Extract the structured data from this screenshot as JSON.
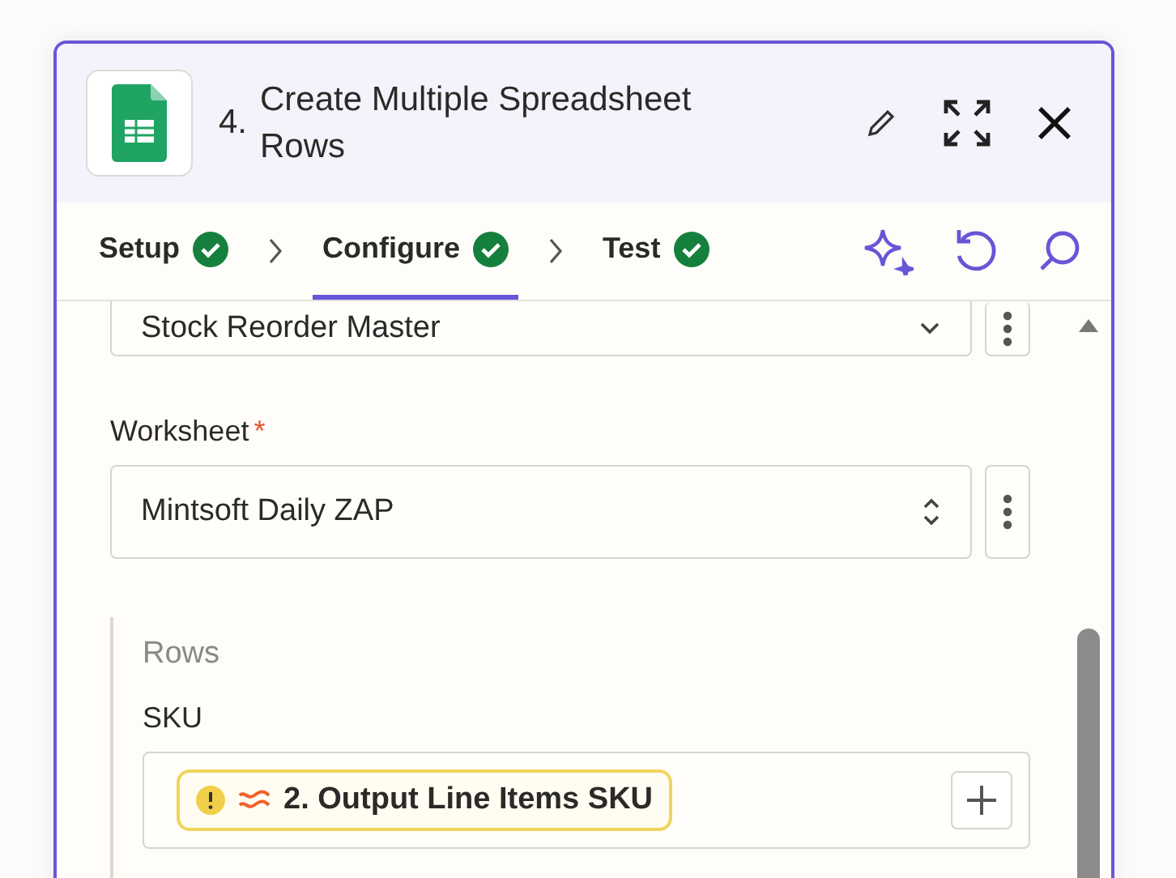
{
  "header": {
    "step": "4.",
    "title": "Create Multiple Spreadsheet Rows"
  },
  "steps": [
    {
      "label": "Setup",
      "selected": false,
      "complete": true
    },
    {
      "label": "Configure",
      "selected": true,
      "complete": true
    },
    {
      "label": "Test",
      "selected": false,
      "complete": true
    }
  ],
  "fields": [
    {
      "kind": "dropdown",
      "value": "Stock Reorder Master"
    },
    {
      "kind": "select",
      "label": "Worksheet",
      "required_mark": "*",
      "value": "Mintsoft Daily ZAP"
    }
  ],
  "rows_section": {
    "title": "Rows",
    "fields": [
      {
        "label": "SKU",
        "token": {
          "text": "2. Output Line Items SKU",
          "warning": true
        }
      }
    ]
  }
}
